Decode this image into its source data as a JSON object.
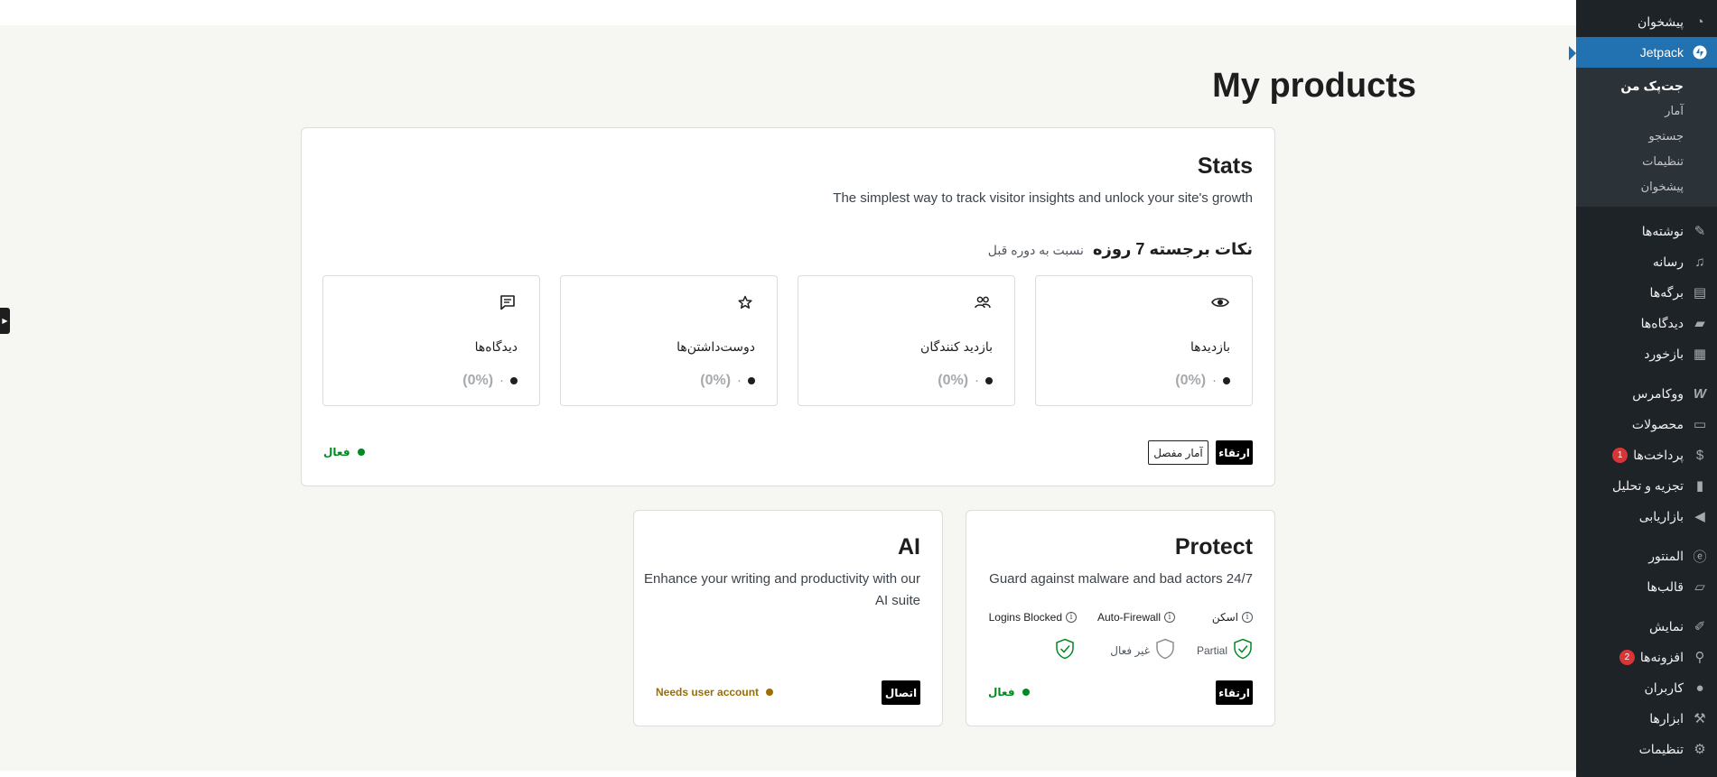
{
  "sidebar": {
    "items_top": [
      {
        "label": "پیشخوان",
        "icon": "dashboard-icon"
      }
    ],
    "active": {
      "label": "Jetpack",
      "icon": "jetpack-icon"
    },
    "submenu": [
      {
        "label": "جت‌پک من",
        "current": true
      },
      {
        "label": "آمار"
      },
      {
        "label": "جستجو"
      },
      {
        "label": "تنظیمات"
      },
      {
        "label": "پیشخوان"
      }
    ],
    "items_group1": [
      {
        "label": "نوشته‌ها",
        "icon": "pin-icon"
      },
      {
        "label": "رسانه",
        "icon": "media-icon"
      },
      {
        "label": "برگه‌ها",
        "icon": "page-icon"
      },
      {
        "label": "دیدگاه‌ها",
        "icon": "comment-icon"
      },
      {
        "label": "بازخورد",
        "icon": "feedback-icon"
      }
    ],
    "items_group2": [
      {
        "label": "ووکامرس",
        "icon": "woocommerce-icon"
      },
      {
        "label": "محصولات",
        "icon": "archive-icon"
      },
      {
        "label": "پرداخت‌ها",
        "icon": "payments-icon",
        "badge": "1"
      },
      {
        "label": "تجزیه و تحلیل",
        "icon": "bar-chart-icon"
      },
      {
        "label": "بازاریابی",
        "icon": "megaphone-icon"
      }
    ],
    "items_group3": [
      {
        "label": "المنتور",
        "icon": "elementor-icon"
      },
      {
        "label": "قالب‌ها",
        "icon": "folder-icon"
      }
    ],
    "items_group4": [
      {
        "label": "نمایش",
        "icon": "brush-icon"
      },
      {
        "label": "افزونه‌ها",
        "icon": "plugin-icon",
        "badge": "2"
      },
      {
        "label": "کاربران",
        "icon": "user-icon"
      },
      {
        "label": "ابزارها",
        "icon": "wrench-icon"
      },
      {
        "label": "تنظیمات",
        "icon": "settings-icon"
      }
    ]
  },
  "page": {
    "title": "My products"
  },
  "stats": {
    "title": "Stats",
    "description": "The simplest way to track visitor insights and unlock your site's growth",
    "highlights_title": "نکات برجسته 7 روزه",
    "highlights_sub": "نسبت به دوره قبل",
    "boxes": [
      {
        "label": "بازدیدها",
        "icon": "eye-icon",
        "value": "۰",
        "pct": "(0%)"
      },
      {
        "label": "بازدید کنندگان",
        "icon": "people-icon",
        "value": "۰",
        "pct": "(0%)"
      },
      {
        "label": "دوست‌داشتن‌ها",
        "icon": "star-icon",
        "value": "۰",
        "pct": "(0%)"
      },
      {
        "label": "دیدگاه‌ها",
        "icon": "comment-icon",
        "value": "۰",
        "pct": "(0%)"
      }
    ],
    "upgrade_label": "ارتقاء",
    "detailed_label": "آمار مفصل",
    "status": "فعال"
  },
  "protect": {
    "title": "Protect",
    "description": "Guard against malware and bad actors 24/7",
    "cols": [
      {
        "label": "اسکن",
        "value": "Partial"
      },
      {
        "label": "Auto-Firewall",
        "value": "غیر فعال"
      },
      {
        "label": "Logins Blocked",
        "value": ""
      }
    ],
    "upgrade_label": "ارتقاء",
    "status": "فعال"
  },
  "ai": {
    "title": "AI",
    "description_line1": "Enhance your writing and productivity with our",
    "description_line2": "AI suite",
    "connect_label": "اتصال",
    "status": "Needs user account"
  },
  "colors": {
    "active_green": "#008a20",
    "warning": "#9d6e00",
    "accent_blue": "#2271b1",
    "sidebar_bg": "#1d2327"
  }
}
